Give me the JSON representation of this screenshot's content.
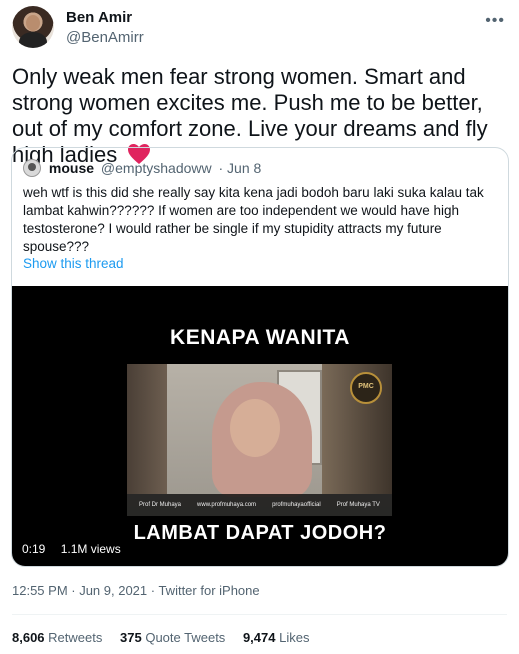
{
  "author": {
    "name": "Ben Amir",
    "handle": "@BenAmirr"
  },
  "tweet": {
    "text": "Only weak men fear strong women. Smart and strong women excites me. Push me to be better, out of my comfort zone. Live your dreams and fly high ladies"
  },
  "quote": {
    "name": "mouse",
    "handle": "@emptyshadoww",
    "date": "· Jun 8",
    "text": "weh wtf is this did she really say kita kena jadi bodoh baru laki suka kalau tak lambat kahwin?????? If women are too independent we would have high testosterone? I would rather be single if my stupidity attracts my future spouse???",
    "show_thread": "Show this thread",
    "video": {
      "caption_top": "KENAPA WANITA",
      "caption_bottom": "LAMBAT DAPAT JODOH?",
      "duration": "0:19",
      "views": "1.1M views",
      "logo": "PMC",
      "social": [
        "Prof Dr Muhaya",
        "www.profmuhaya.com",
        "profmuhayaofficial",
        "Prof Muhaya TV"
      ]
    }
  },
  "meta": {
    "timestamp": "12:55 PM · Jun 9, 2021 · Twitter for iPhone"
  },
  "stats": [
    {
      "value": "8,606",
      "label": "Retweets"
    },
    {
      "value": "375",
      "label": "Quote Tweets"
    },
    {
      "value": "9,474",
      "label": "Likes"
    }
  ],
  "icons": {
    "heart": "red-heart-emoji",
    "more": "more-options-icon"
  },
  "colors": {
    "link": "#1d9bf0",
    "heart": "#e0245e"
  }
}
